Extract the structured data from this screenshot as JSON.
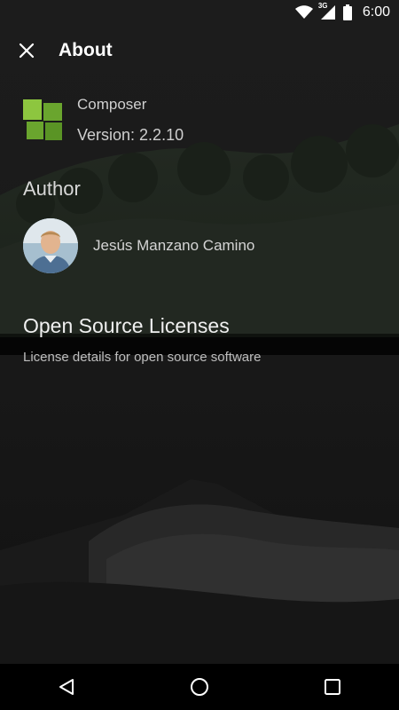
{
  "status_bar": {
    "time": "6:00",
    "network_label": "3G",
    "icons": [
      "wifi-icon",
      "cell-signal-icon",
      "battery-icon"
    ]
  },
  "toolbar": {
    "title": "About",
    "close_icon": "close-icon"
  },
  "app": {
    "name": "Composer",
    "version": "Version: 2.2.10",
    "logo_colors": [
      "#8dc63f",
      "#6aa52e",
      "#5a9425"
    ]
  },
  "author_section": {
    "heading": "Author",
    "name": "Jesús Manzano Camino"
  },
  "licenses": {
    "title": "Open Source Licenses",
    "subtitle": "License details for open source software"
  },
  "nav_bar": {
    "icons": [
      "back-icon",
      "home-icon",
      "recents-icon"
    ]
  },
  "colors": {
    "text_primary": "#f0f0f0",
    "text_secondary": "#bdbdbd",
    "nav_background": "#000000"
  }
}
